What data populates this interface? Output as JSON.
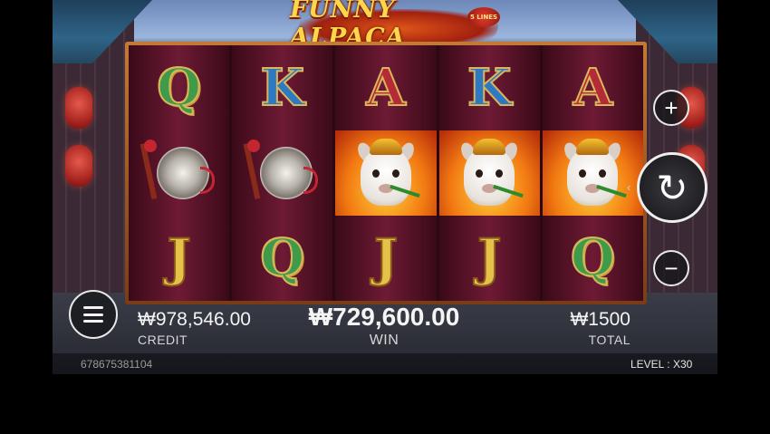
{
  "game": {
    "title": "FUNNY ALPACA",
    "lines_badge": "5 LINES"
  },
  "reels": [
    [
      "Q",
      "gong",
      "J"
    ],
    [
      "K",
      "gong",
      "Q"
    ],
    [
      "A",
      "alpaca",
      "J"
    ],
    [
      "K",
      "alpaca",
      "J"
    ],
    [
      "A",
      "alpaca",
      "Q"
    ]
  ],
  "controls": {
    "plus_icon": "+",
    "minus_icon": "−",
    "spin_icon": "↻",
    "spin_hint": "‹"
  },
  "credit": {
    "value": "₩978,546.00",
    "label": "CREDIT"
  },
  "win": {
    "value": "₩729,600.00",
    "label": "WIN"
  },
  "total": {
    "value": "₩1500",
    "label": "TOTAL"
  },
  "footer": {
    "session_id": "678675381104",
    "level_label": "LEVEL :",
    "level_value": "X30"
  }
}
